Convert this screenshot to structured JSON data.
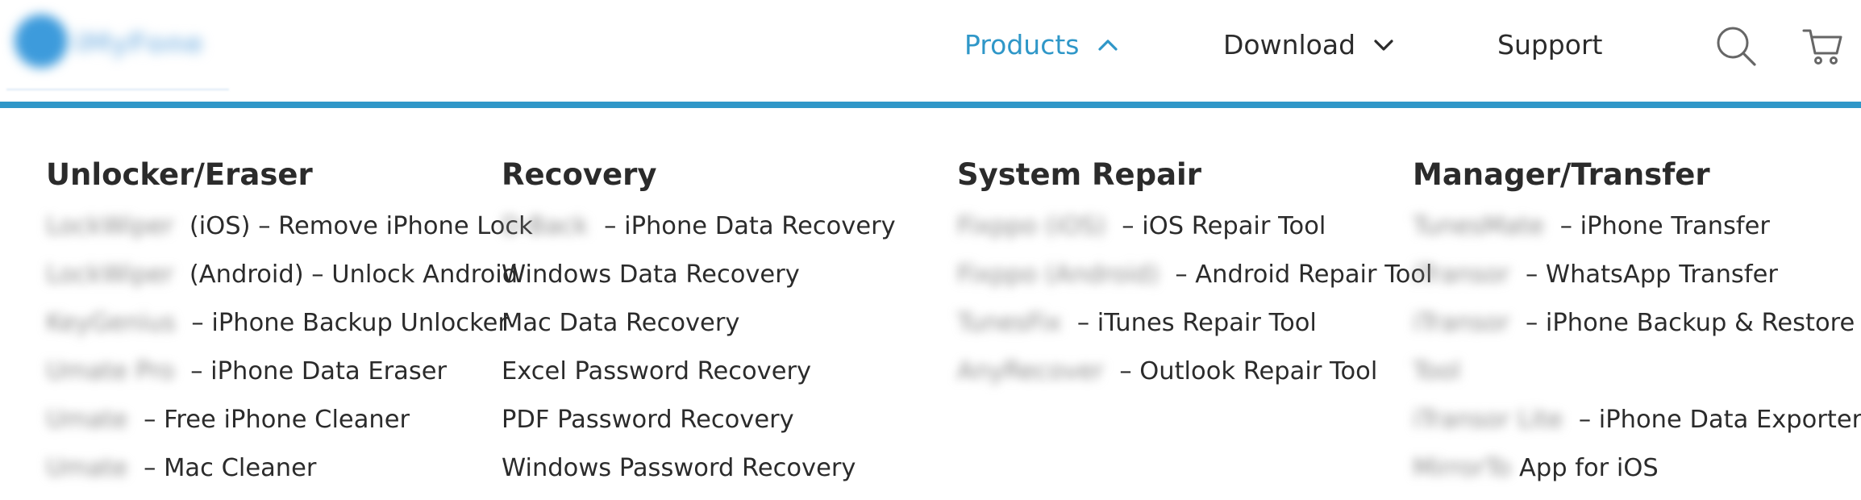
{
  "header": {
    "logo_text": "iMyFone",
    "nav": {
      "products": "Products",
      "download": "Download",
      "support": "Support"
    },
    "icons": [
      "search-icon",
      "cart-icon"
    ],
    "accent_color": "#2f97c8"
  },
  "menu": {
    "columns": [
      {
        "title": "Unlocker/Eraser",
        "items": [
          {
            "brand": "LockWiper",
            "text": " (iOS) – Remove iPhone Lock"
          },
          {
            "brand": "LockWiper",
            "text": " (Android) – Unlock Android"
          },
          {
            "brand": "KeyGenius",
            "text": " – iPhone Backup Unlocker"
          },
          {
            "brand": "Umate Pro",
            "text": " – iPhone Data Eraser"
          },
          {
            "brand": "Umate",
            "text": " – Free iPhone Cleaner"
          },
          {
            "brand": "Umate",
            "text": " – Mac Cleaner"
          }
        ]
      },
      {
        "title": "Recovery",
        "items": [
          {
            "brand": "D-Back",
            "text": " – iPhone Data Recovery"
          },
          {
            "brand": "",
            "text": "Windows Data Recovery"
          },
          {
            "brand": "",
            "text": "Mac Data Recovery"
          },
          {
            "brand": "",
            "text": "Excel Password Recovery"
          },
          {
            "brand": "",
            "text": "PDF Password Recovery"
          },
          {
            "brand": "",
            "text": "Windows Password Recovery"
          }
        ]
      },
      {
        "title": "System Repair",
        "items": [
          {
            "brand": "Fixppo (iOS)",
            "text": " – iOS Repair Tool"
          },
          {
            "brand": "Fixppo (Android)",
            "text": " – Android Repair Tool"
          },
          {
            "brand": "TunesFix",
            "text": " – iTunes Repair Tool"
          },
          {
            "brand": "AnyRecover",
            "text": " – Outlook Repair Tool"
          }
        ]
      },
      {
        "title": "Manager/Transfer",
        "items": [
          {
            "brand": "TunesMate",
            "text": " – iPhone Transfer"
          },
          {
            "brand": "iTransor",
            "text": " – WhatsApp Transfer"
          },
          {
            "brand": "iTransor",
            "text": " – iPhone Backup & Restore"
          },
          {
            "brand": "Tool",
            "text": ""
          },
          {
            "brand": "iTransor Lite",
            "text": " – iPhone Data Exporter"
          },
          {
            "brand": "MirrorTo",
            "text": "App for iOS"
          }
        ]
      }
    ]
  }
}
